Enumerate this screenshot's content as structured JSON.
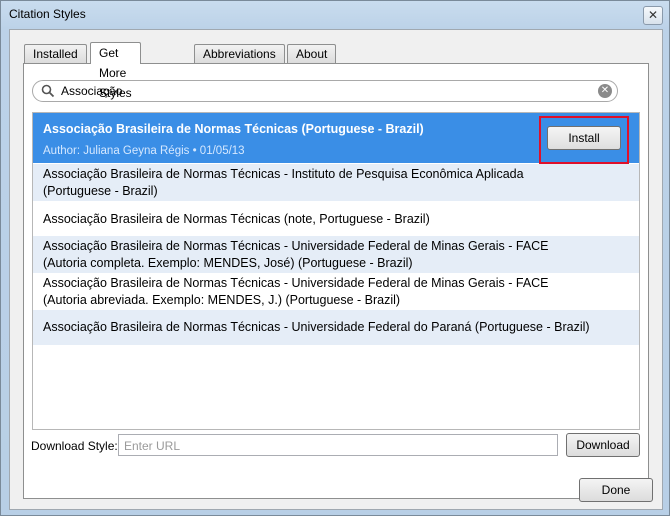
{
  "window": {
    "title": "Citation Styles",
    "close_glyph": "✕"
  },
  "tabs": [
    {
      "label": "Installed",
      "active": false
    },
    {
      "label": "Get More Styles",
      "active": true
    },
    {
      "label": "Abbreviations",
      "active": false
    },
    {
      "label": "About",
      "active": false
    }
  ],
  "search": {
    "value": "Associação",
    "icon": "search-icon",
    "clear_icon": "clear-icon",
    "clear_glyph": "✕"
  },
  "results": {
    "selected": {
      "name": "Associação Brasileira de Normas Técnicas (Portuguese - Brazil)",
      "meta": "Author: Juliana Geyna Régis • 01/05/13",
      "install_label": "Install"
    },
    "items": [
      {
        "lines": [
          "Associação Brasileira de Normas Técnicas - Instituto de Pesquisa Econômica Aplicada",
          "(Portuguese - Brazil)"
        ]
      },
      {
        "lines": [
          "Associação Brasileira de Normas Técnicas (note, Portuguese - Brazil)"
        ]
      },
      {
        "lines": [
          "Associação Brasileira de Normas Técnicas - Universidade Federal de Minas Gerais - FACE",
          "(Autoria completa. Exemplo: MENDES, José) (Portuguese - Brazil)"
        ]
      },
      {
        "lines": [
          "Associação Brasileira de Normas Técnicas - Universidade Federal de Minas Gerais - FACE",
          "(Autoria abreviada. Exemplo: MENDES, J.) (Portuguese - Brazil)"
        ]
      },
      {
        "lines": [
          "Associação Brasileira de Normas Técnicas - Universidade Federal do Paraná (Portuguese - Brazil)"
        ]
      }
    ]
  },
  "download": {
    "label": "Download Style:",
    "placeholder": "Enter URL",
    "button_label": "Download"
  },
  "footer": {
    "done_label": "Done"
  },
  "colors": {
    "selection": "#3a8ee6",
    "alt_row": "#e5edf7",
    "highlight_box": "#e0102a"
  }
}
